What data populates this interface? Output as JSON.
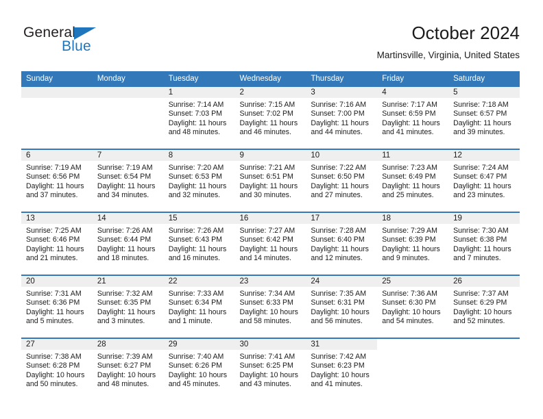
{
  "logo": {
    "word1": "General",
    "word2": "Blue",
    "triangle_color": "#1f76bc"
  },
  "header": {
    "title": "October 2024",
    "subtitle": "Martinsville, Virginia, United States",
    "header_bg": "#3379b9",
    "daynum_bg": "#efefef"
  },
  "weekdays": [
    "Sunday",
    "Monday",
    "Tuesday",
    "Wednesday",
    "Thursday",
    "Friday",
    "Saturday"
  ],
  "labels": {
    "sunrise_prefix": "Sunrise:",
    "sunset_prefix": "Sunset:",
    "daylight_prefix": "Daylight:"
  },
  "weeks": [
    [
      {
        "day": "",
        "blank": true
      },
      {
        "day": "",
        "blank": true
      },
      {
        "day": "1",
        "sunrise": "Sunrise: 7:14 AM",
        "sunset": "Sunset: 7:03 PM",
        "daylight_l1": "Daylight: 11 hours",
        "daylight_l2": "and 48 minutes."
      },
      {
        "day": "2",
        "sunrise": "Sunrise: 7:15 AM",
        "sunset": "Sunset: 7:02 PM",
        "daylight_l1": "Daylight: 11 hours",
        "daylight_l2": "and 46 minutes."
      },
      {
        "day": "3",
        "sunrise": "Sunrise: 7:16 AM",
        "sunset": "Sunset: 7:00 PM",
        "daylight_l1": "Daylight: 11 hours",
        "daylight_l2": "and 44 minutes."
      },
      {
        "day": "4",
        "sunrise": "Sunrise: 7:17 AM",
        "sunset": "Sunset: 6:59 PM",
        "daylight_l1": "Daylight: 11 hours",
        "daylight_l2": "and 41 minutes."
      },
      {
        "day": "5",
        "sunrise": "Sunrise: 7:18 AM",
        "sunset": "Sunset: 6:57 PM",
        "daylight_l1": "Daylight: 11 hours",
        "daylight_l2": "and 39 minutes."
      }
    ],
    [
      {
        "day": "6",
        "sunrise": "Sunrise: 7:19 AM",
        "sunset": "Sunset: 6:56 PM",
        "daylight_l1": "Daylight: 11 hours",
        "daylight_l2": "and 37 minutes."
      },
      {
        "day": "7",
        "sunrise": "Sunrise: 7:19 AM",
        "sunset": "Sunset: 6:54 PM",
        "daylight_l1": "Daylight: 11 hours",
        "daylight_l2": "and 34 minutes."
      },
      {
        "day": "8",
        "sunrise": "Sunrise: 7:20 AM",
        "sunset": "Sunset: 6:53 PM",
        "daylight_l1": "Daylight: 11 hours",
        "daylight_l2": "and 32 minutes."
      },
      {
        "day": "9",
        "sunrise": "Sunrise: 7:21 AM",
        "sunset": "Sunset: 6:51 PM",
        "daylight_l1": "Daylight: 11 hours",
        "daylight_l2": "and 30 minutes."
      },
      {
        "day": "10",
        "sunrise": "Sunrise: 7:22 AM",
        "sunset": "Sunset: 6:50 PM",
        "daylight_l1": "Daylight: 11 hours",
        "daylight_l2": "and 27 minutes."
      },
      {
        "day": "11",
        "sunrise": "Sunrise: 7:23 AM",
        "sunset": "Sunset: 6:49 PM",
        "daylight_l1": "Daylight: 11 hours",
        "daylight_l2": "and 25 minutes."
      },
      {
        "day": "12",
        "sunrise": "Sunrise: 7:24 AM",
        "sunset": "Sunset: 6:47 PM",
        "daylight_l1": "Daylight: 11 hours",
        "daylight_l2": "and 23 minutes."
      }
    ],
    [
      {
        "day": "13",
        "sunrise": "Sunrise: 7:25 AM",
        "sunset": "Sunset: 6:46 PM",
        "daylight_l1": "Daylight: 11 hours",
        "daylight_l2": "and 21 minutes."
      },
      {
        "day": "14",
        "sunrise": "Sunrise: 7:26 AM",
        "sunset": "Sunset: 6:44 PM",
        "daylight_l1": "Daylight: 11 hours",
        "daylight_l2": "and 18 minutes."
      },
      {
        "day": "15",
        "sunrise": "Sunrise: 7:26 AM",
        "sunset": "Sunset: 6:43 PM",
        "daylight_l1": "Daylight: 11 hours",
        "daylight_l2": "and 16 minutes."
      },
      {
        "day": "16",
        "sunrise": "Sunrise: 7:27 AM",
        "sunset": "Sunset: 6:42 PM",
        "daylight_l1": "Daylight: 11 hours",
        "daylight_l2": "and 14 minutes."
      },
      {
        "day": "17",
        "sunrise": "Sunrise: 7:28 AM",
        "sunset": "Sunset: 6:40 PM",
        "daylight_l1": "Daylight: 11 hours",
        "daylight_l2": "and 12 minutes."
      },
      {
        "day": "18",
        "sunrise": "Sunrise: 7:29 AM",
        "sunset": "Sunset: 6:39 PM",
        "daylight_l1": "Daylight: 11 hours",
        "daylight_l2": "and 9 minutes."
      },
      {
        "day": "19",
        "sunrise": "Sunrise: 7:30 AM",
        "sunset": "Sunset: 6:38 PM",
        "daylight_l1": "Daylight: 11 hours",
        "daylight_l2": "and 7 minutes."
      }
    ],
    [
      {
        "day": "20",
        "sunrise": "Sunrise: 7:31 AM",
        "sunset": "Sunset: 6:36 PM",
        "daylight_l1": "Daylight: 11 hours",
        "daylight_l2": "and 5 minutes."
      },
      {
        "day": "21",
        "sunrise": "Sunrise: 7:32 AM",
        "sunset": "Sunset: 6:35 PM",
        "daylight_l1": "Daylight: 11 hours",
        "daylight_l2": "and 3 minutes."
      },
      {
        "day": "22",
        "sunrise": "Sunrise: 7:33 AM",
        "sunset": "Sunset: 6:34 PM",
        "daylight_l1": "Daylight: 11 hours",
        "daylight_l2": "and 1 minute."
      },
      {
        "day": "23",
        "sunrise": "Sunrise: 7:34 AM",
        "sunset": "Sunset: 6:33 PM",
        "daylight_l1": "Daylight: 10 hours",
        "daylight_l2": "and 58 minutes."
      },
      {
        "day": "24",
        "sunrise": "Sunrise: 7:35 AM",
        "sunset": "Sunset: 6:31 PM",
        "daylight_l1": "Daylight: 10 hours",
        "daylight_l2": "and 56 minutes."
      },
      {
        "day": "25",
        "sunrise": "Sunrise: 7:36 AM",
        "sunset": "Sunset: 6:30 PM",
        "daylight_l1": "Daylight: 10 hours",
        "daylight_l2": "and 54 minutes."
      },
      {
        "day": "26",
        "sunrise": "Sunrise: 7:37 AM",
        "sunset": "Sunset: 6:29 PM",
        "daylight_l1": "Daylight: 10 hours",
        "daylight_l2": "and 52 minutes."
      }
    ],
    [
      {
        "day": "27",
        "sunrise": "Sunrise: 7:38 AM",
        "sunset": "Sunset: 6:28 PM",
        "daylight_l1": "Daylight: 10 hours",
        "daylight_l2": "and 50 minutes."
      },
      {
        "day": "28",
        "sunrise": "Sunrise: 7:39 AM",
        "sunset": "Sunset: 6:27 PM",
        "daylight_l1": "Daylight: 10 hours",
        "daylight_l2": "and 48 minutes."
      },
      {
        "day": "29",
        "sunrise": "Sunrise: 7:40 AM",
        "sunset": "Sunset: 6:26 PM",
        "daylight_l1": "Daylight: 10 hours",
        "daylight_l2": "and 45 minutes."
      },
      {
        "day": "30",
        "sunrise": "Sunrise: 7:41 AM",
        "sunset": "Sunset: 6:25 PM",
        "daylight_l1": "Daylight: 10 hours",
        "daylight_l2": "and 43 minutes."
      },
      {
        "day": "31",
        "sunrise": "Sunrise: 7:42 AM",
        "sunset": "Sunset: 6:23 PM",
        "daylight_l1": "Daylight: 10 hours",
        "daylight_l2": "and 41 minutes."
      },
      {
        "day": "",
        "blank": true
      },
      {
        "day": "",
        "blank": true
      }
    ]
  ]
}
